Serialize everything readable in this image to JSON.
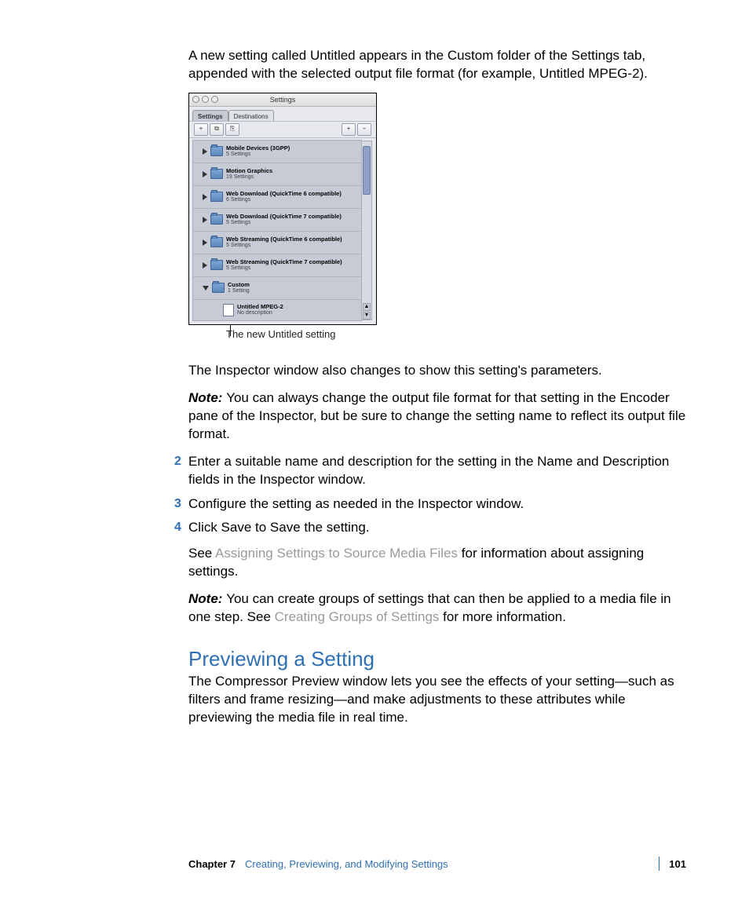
{
  "intro": "A new setting called Untitled appears in the Custom folder of the Settings tab, appended with the selected output file format (for example, Untitled MPEG-2).",
  "inset": {
    "window_title": "Settings",
    "tabs": {
      "settings": "Settings",
      "destinations": "Destinations"
    },
    "toolbar": {
      "new_setting": "+",
      "new_group": "⧉",
      "duplicate": "⎘",
      "add": "+",
      "remove": "−"
    },
    "rows": [
      {
        "title": "Mobile Devices (3GPP)",
        "sub": "5 Settings",
        "open": false
      },
      {
        "title": "Motion Graphics",
        "sub": "19 Settings",
        "open": false
      },
      {
        "title": "Web Download (QuickTime 6 compatible)",
        "sub": "6 Settings",
        "open": false
      },
      {
        "title": "Web Download (QuickTime 7 compatible)",
        "sub": "5 Settings",
        "open": false
      },
      {
        "title": "Web Streaming (QuickTime 6 compatible)",
        "sub": "5 Settings",
        "open": false
      },
      {
        "title": "Web Streaming (QuickTime 7 compatible)",
        "sub": "5 Settings",
        "open": false
      },
      {
        "title": "Custom",
        "sub": "1 Setting",
        "open": true
      }
    ],
    "custom_child": {
      "title": "Untitled MPEG-2",
      "sub": "No description"
    }
  },
  "caption": "The new Untitled setting",
  "after_image": "The Inspector window also changes to show this setting's parameters.",
  "note1_label": "Note:",
  "note1": "You can always change the output file format for that setting in the Encoder pane of the Inspector, but be sure to change the setting name to reflect its output file format.",
  "steps": {
    "s2_num": "2",
    "s2": "Enter a suitable name and description for the setting in the Name and Description fields in the Inspector window.",
    "s3_num": "3",
    "s3": "Configure the setting as needed in the Inspector window.",
    "s4_num": "4",
    "s4": "Click Save to Save the setting."
  },
  "see1_pre": "See ",
  "see1_link": "Assigning Settings to Source Media Files",
  "see1_post": " for information about assigning settings.",
  "note2_label": "Note:",
  "note2_pre": "You can create groups of settings that can then be applied to a media file in one step. See ",
  "note2_link": "Creating Groups of Settings",
  "note2_post": " for more information.",
  "section_heading": "Previewing a Setting",
  "section_body": "The Compressor Preview window lets you see the effects of your setting—such as filters and frame resizing—and make adjustments to these attributes while previewing the media file in real time.",
  "footer": {
    "chapter": "Chapter 7",
    "title": "Creating, Previewing, and Modifying Settings",
    "page": "101"
  }
}
